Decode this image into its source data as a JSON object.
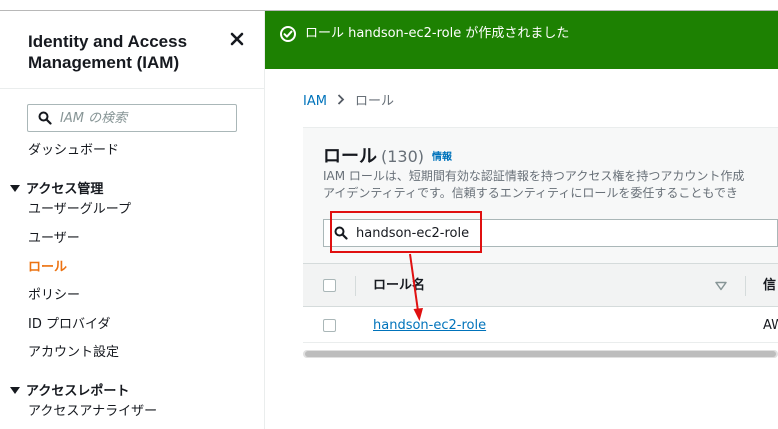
{
  "sidebar": {
    "title": "Identity and Access Management (IAM)",
    "search_placeholder": "IAM の検索",
    "items": [
      {
        "label": "ダッシュボード"
      },
      {
        "label": "アクセス管理"
      },
      {
        "label": "ユーザーグループ"
      },
      {
        "label": "ユーザー"
      },
      {
        "label": "ロール"
      },
      {
        "label": "ポリシー"
      },
      {
        "label": "ID プロバイダ"
      },
      {
        "label": "アカウント設定"
      },
      {
        "label": "アクセスレポート"
      },
      {
        "label": "アクセスアナライザー"
      }
    ]
  },
  "flash": {
    "message": "ロール handson-ec2-role が作成されました",
    "color": "#1d8102"
  },
  "breadcrumb": {
    "root": "IAM",
    "current": "ロール"
  },
  "roles": {
    "title": "ロール",
    "count": "(130)",
    "info": "情報",
    "description_line1": "IAM ロールは、短期間有効な認証情報を持つアクセス権を持つアカウント作成",
    "description_line2": "アイデンティティです。信頼するエンティティにロールを委任することもでき",
    "search_value": "handson-ec2-role",
    "columns": [
      "ロール名",
      "信"
    ],
    "rows": [
      {
        "name": "handson-ec2-role",
        "trusted": "AW"
      }
    ]
  },
  "colors": {
    "accent": "#ec7211",
    "link": "#0073bb",
    "annotation": "#e01010"
  }
}
